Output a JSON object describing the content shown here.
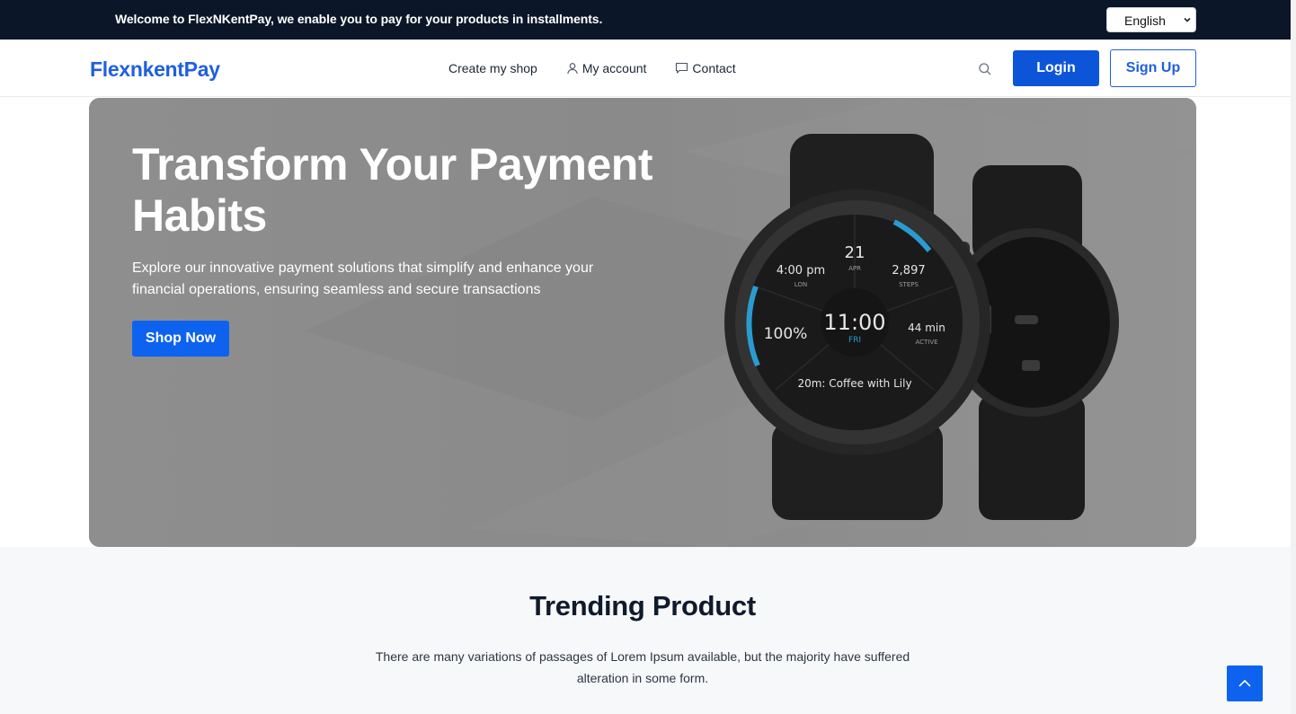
{
  "topbar": {
    "welcome": "Welcome to FlexNKentPay, we enable you to pay for your products in installments.",
    "language": "English"
  },
  "header": {
    "logo": "FlexnkentPay",
    "nav": [
      {
        "label": "Create my shop",
        "icon": null
      },
      {
        "label": "My account",
        "icon": "user-icon"
      },
      {
        "label": "Contact",
        "icon": "chat-icon"
      }
    ],
    "login": "Login",
    "signup": "Sign Up"
  },
  "hero": {
    "title": "Transform Your Payment Habits",
    "subtitle": "Explore our innovative payment solutions that simplify and enhance your financial operations, ensuring seamless and secure transactions",
    "cta": "Shop Now",
    "watch_face": {
      "date": "21",
      "month": "APR",
      "time_left": "4:00 pm",
      "zone": "LON",
      "steps": "2,897",
      "steps_label": "STEPS",
      "battery": "100%",
      "clock": "11:00",
      "day": "FRI",
      "active": "44 min",
      "active_label": "ACTIVE",
      "event": "20m: Coffee with Lily"
    }
  },
  "trending": {
    "title": "Trending Product",
    "description": "There are many variations of passages of Lorem Ipsum available, but the majority have suffered alteration in some form."
  },
  "colors": {
    "topbar_bg": "#0b1628",
    "primary": "#0d55d8",
    "logo": "#1f5fe0",
    "hero_bg": "#8c8c8c"
  }
}
